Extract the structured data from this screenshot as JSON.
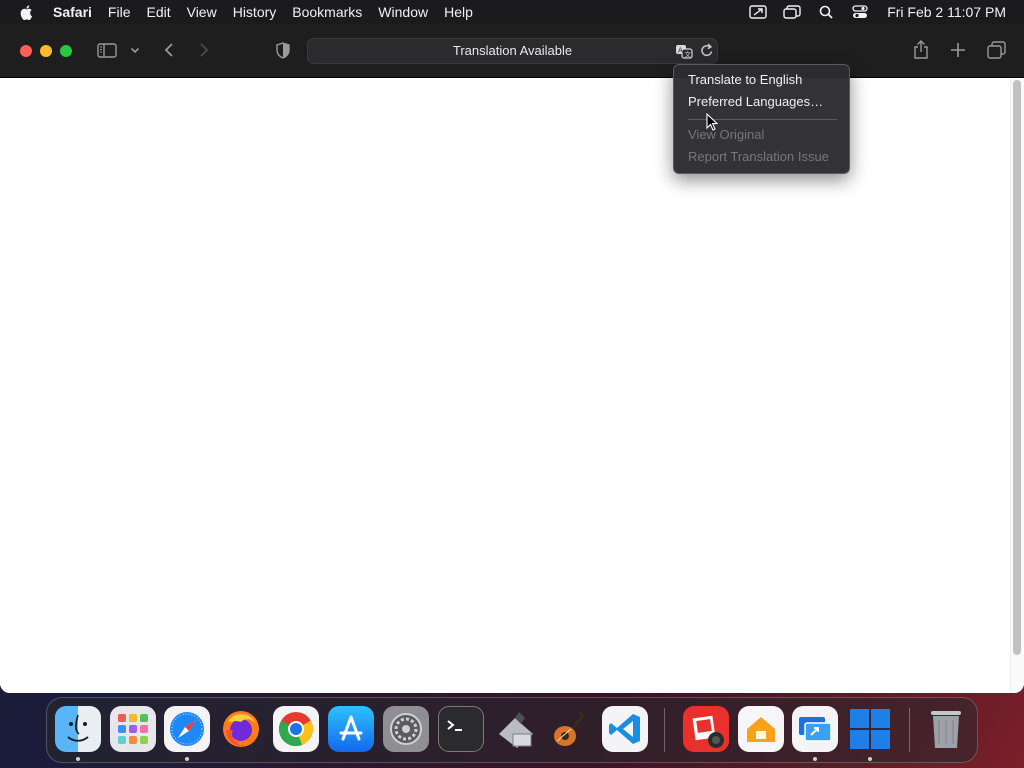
{
  "menubar": {
    "app_name": "Safari",
    "items": [
      "File",
      "Edit",
      "View",
      "History",
      "Bookmarks",
      "Window",
      "Help"
    ],
    "clock": "Fri Feb 2  11:07 PM",
    "status_icons": [
      "screen-mirroring-icon",
      "stage-manager-icon",
      "spotlight-search-icon",
      "control-center-icon"
    ]
  },
  "toolbar": {
    "address_text": "Translation Available",
    "icons": [
      "sidebar-icon",
      "chevron-down-icon",
      "back-icon",
      "forward-icon",
      "privacy-shield-icon",
      "translate-icon",
      "reload-icon",
      "share-icon",
      "new-tab-icon",
      "tab-overview-icon"
    ]
  },
  "translate_menu": {
    "items": [
      {
        "label": "Translate to English",
        "enabled": true
      },
      {
        "label": "Preferred Languages…",
        "enabled": true
      },
      {
        "label": "View Original",
        "enabled": false
      },
      {
        "label": "Report Translation Issue",
        "enabled": false
      }
    ]
  },
  "dock": {
    "apps": [
      "finder-icon",
      "launchpad-icon",
      "safari-icon",
      "firefox-icon",
      "chrome-icon",
      "app-store-icon",
      "system-settings-icon",
      "terminal-icon",
      "migration-assistant-icon",
      "garageband-icon",
      "vscode-icon",
      "photo-booth-icon",
      "home-icon",
      "remote-desktop-icon",
      "windows-icon",
      "trash-icon"
    ],
    "colors": {
      "finder": "#3b9cf0",
      "safari": "#1e88f5",
      "vscode": "#1a8fe0",
      "chrome": "#e33b2e",
      "windows": "#1f7fe8"
    }
  }
}
